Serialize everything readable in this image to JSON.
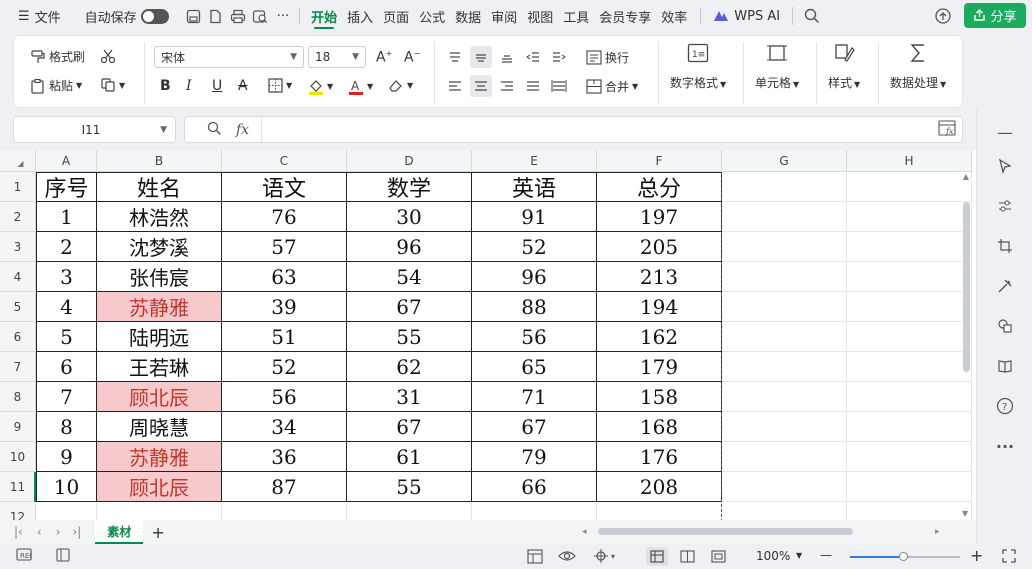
{
  "menubar": {
    "file_label": "文件",
    "autosave_label": "自动保存",
    "more_label": "···",
    "tabs": [
      "开始",
      "插入",
      "页面",
      "公式",
      "数据",
      "审阅",
      "视图",
      "工具",
      "会员专享",
      "效率"
    ],
    "wps_ai_label": "WPS AI",
    "share_label": "分享"
  },
  "ribbon": {
    "format_painter": "格式刷",
    "paste": "粘贴",
    "font_name": "宋体",
    "font_size": "18",
    "wrap": "换行",
    "merge": "合并",
    "number_format": "数字格式",
    "cell": "单元格",
    "style": "样式",
    "data_process": "数据处理",
    "bold": "B",
    "italic": "I",
    "underline": "U",
    "strike": "A"
  },
  "formula": {
    "name_box": "I11",
    "fx": "fx",
    "content": ""
  },
  "sheet": {
    "columns": [
      "A",
      "B",
      "C",
      "D",
      "E",
      "F",
      "G",
      "H"
    ],
    "rows": [
      "1",
      "2",
      "3",
      "4",
      "5",
      "6",
      "7",
      "8",
      "9",
      "10",
      "11",
      "12"
    ],
    "header": [
      "序号",
      "姓名",
      "语文",
      "数学",
      "英语",
      "总分"
    ],
    "data": [
      [
        "1",
        "林浩然",
        "76",
        "30",
        "91",
        "197"
      ],
      [
        "2",
        "沈梦溪",
        "57",
        "96",
        "52",
        "205"
      ],
      [
        "3",
        "张伟宸",
        "63",
        "54",
        "96",
        "213"
      ],
      [
        "4",
        "苏静雅",
        "39",
        "67",
        "88",
        "194"
      ],
      [
        "5",
        "陆明远",
        "51",
        "55",
        "56",
        "162"
      ],
      [
        "6",
        "王若琳",
        "52",
        "62",
        "65",
        "179"
      ],
      [
        "7",
        "顾北辰",
        "56",
        "31",
        "71",
        "158"
      ],
      [
        "8",
        "周晓慧",
        "34",
        "67",
        "67",
        "168"
      ],
      [
        "9",
        "苏静雅",
        "36",
        "61",
        "79",
        "176"
      ],
      [
        "10",
        "顾北辰",
        "87",
        "55",
        "66",
        "208"
      ]
    ],
    "highlighted_rows": [
      3,
      6,
      8,
      9
    ],
    "highlight_fill": "#f8c9cc",
    "highlight_text": "#c0392b"
  },
  "sheetbar": {
    "sheet_name": "素材",
    "add": "+"
  },
  "statusbar": {
    "zoom": "100%",
    "minus": "—",
    "plus": "+"
  },
  "colors": {
    "accent": "#0a8a4a",
    "share": "#1aab5d"
  }
}
